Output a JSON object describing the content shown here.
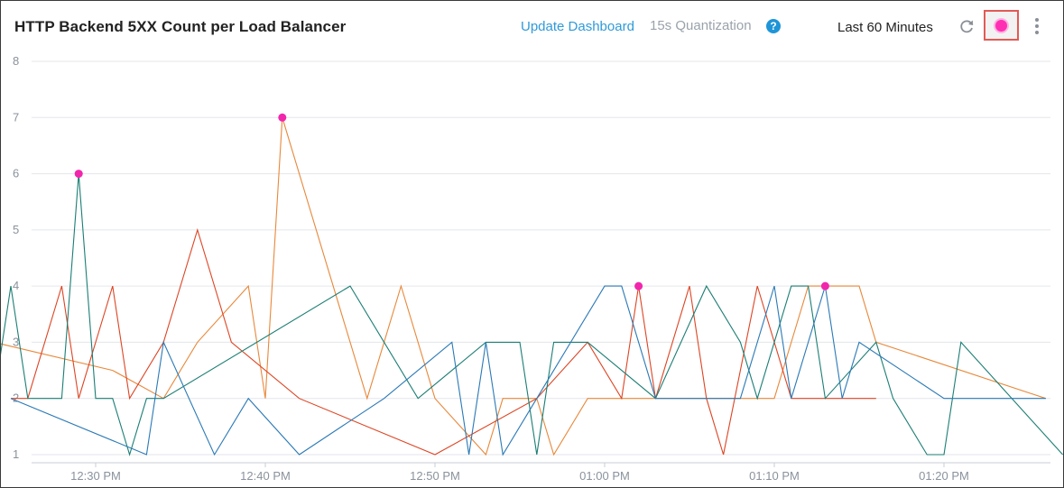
{
  "panel": {
    "title": "HTTP Backend 5XX Count per Load Balancer",
    "update_label": "Update Dashboard",
    "quantization_label": "15s Quantization",
    "help_glyph": "?",
    "time_range": "Last 60 Minutes",
    "icons": [
      "refresh-icon",
      "live-mode-icon",
      "more-options-icon"
    ]
  },
  "chart_data": {
    "type": "line",
    "ylim": [
      1,
      8
    ],
    "yticks": [
      "8",
      "7",
      "6",
      "5",
      "4",
      "3",
      "2",
      "1"
    ],
    "xlim": [
      "12:24",
      "01:27"
    ],
    "xticks": [
      "12:30 PM",
      "12:40 PM",
      "12:50 PM",
      "01:00 PM",
      "01:10 PM",
      "01:20 PM"
    ],
    "grid": true,
    "series": [
      {
        "color": "#e8883a",
        "x": [
          "12:24",
          "12:31",
          "12:34",
          "12:36",
          "12:39",
          "12:40",
          "12:41",
          "12:46",
          "12:48",
          "12:50",
          "12:53",
          "12:54",
          "12:56",
          "12:57",
          "12:59",
          "01:10",
          "01:12",
          "01:14",
          "01:15",
          "01:16",
          "01:26"
        ],
        "y": [
          3,
          2.5,
          2,
          3,
          4,
          2,
          7,
          2,
          4,
          2,
          1,
          2,
          2,
          1,
          2,
          2,
          4,
          4,
          4,
          3,
          2
        ]
      },
      {
        "color": "#dd4423",
        "x": [
          "12:25",
          "12:26",
          "12:28",
          "12:29",
          "12:30",
          "12:31",
          "12:32",
          "12:34",
          "12:35",
          "12:36",
          "12:38",
          "12:42",
          "12:50",
          "12:56",
          "12:59",
          "01:01",
          "01:02",
          "01:03",
          "01:05",
          "01:06",
          "01:07",
          "01:09",
          "01:10",
          "01:11",
          "01:14",
          "01:15",
          "01:16"
        ],
        "y": [
          2,
          2,
          4,
          2,
          3,
          4,
          2,
          3,
          4,
          5,
          3,
          2,
          1,
          2,
          3,
          2,
          4,
          2,
          4,
          2,
          1,
          4,
          3,
          2,
          2,
          2,
          2
        ]
      },
      {
        "color": "#1b7e74",
        "x": [
          "12:24",
          "12:25",
          "12:26",
          "12:27",
          "12:28",
          "12:29",
          "12:30",
          "12:31",
          "12:32",
          "12:33",
          "12:34",
          "12:45",
          "12:49",
          "12:53",
          "12:55",
          "12:56",
          "12:57",
          "12:59",
          "01:03",
          "01:06",
          "01:08",
          "01:09",
          "01:11",
          "01:12",
          "01:13",
          "01:16",
          "01:17",
          "01:19",
          "01:20",
          "01:21",
          "01:27"
        ],
        "y": [
          2,
          4,
          2,
          2,
          2,
          6,
          2,
          2,
          1,
          2,
          2,
          4,
          2,
          3,
          3,
          1,
          3,
          3,
          2,
          4,
          3,
          2,
          4,
          4,
          2,
          3,
          2,
          1,
          1,
          3,
          1
        ]
      },
      {
        "color": "#2a79b6",
        "x": [
          "12:25",
          "12:33",
          "12:34",
          "12:37",
          "12:39",
          "12:42",
          "12:47",
          "12:51",
          "12:52",
          "12:53",
          "12:54",
          "12:56",
          "12:58",
          "01:00",
          "01:01",
          "01:03",
          "01:04",
          "01:08",
          "01:10",
          "01:11",
          "01:13",
          "01:14",
          "01:15",
          "01:20",
          "01:26"
        ],
        "y": [
          2,
          1,
          3,
          1,
          2,
          1,
          2,
          3,
          1,
          3,
          1,
          2,
          3,
          4,
          4,
          2,
          2,
          2,
          4,
          2,
          4,
          2,
          3,
          2,
          2
        ]
      }
    ],
    "annotations": [
      {
        "x": "12:29",
        "y": 6
      },
      {
        "x": "12:41",
        "y": 7
      },
      {
        "x": "01:02",
        "y": 4
      },
      {
        "x": "01:13",
        "y": 4
      }
    ]
  }
}
